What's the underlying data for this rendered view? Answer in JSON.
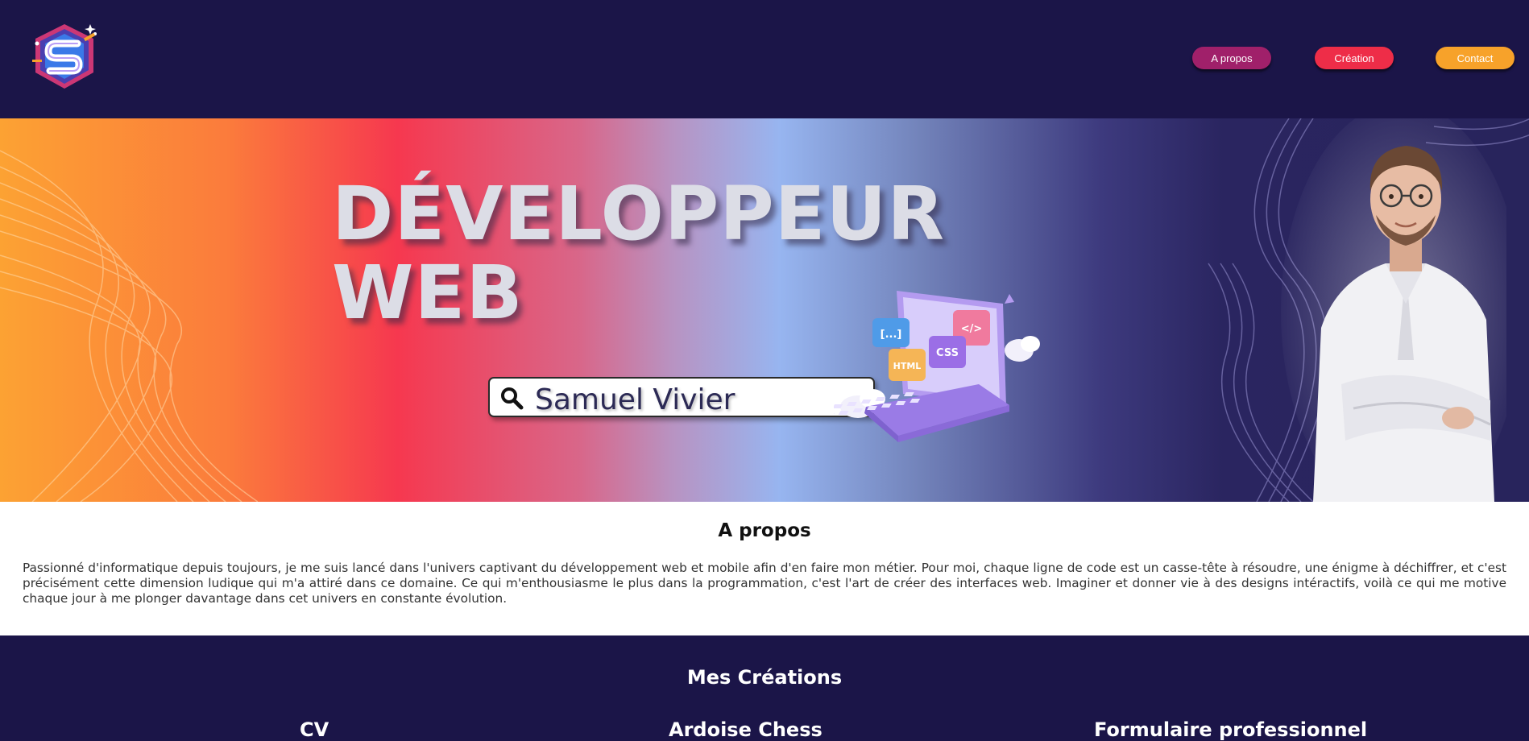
{
  "header": {
    "nav": [
      {
        "label": "A propos",
        "color": "#a0206a"
      },
      {
        "label": "Création",
        "color": "#ee2d48"
      },
      {
        "label": "Contact",
        "color": "#f7a22a"
      }
    ]
  },
  "hero": {
    "title_line1": "DÉVELOPPEUR",
    "title_line2": "WEB",
    "search_value": "Samuel Vivier",
    "laptop_labels": {
      "brackets": "[...]",
      "code": "</>",
      "html": "HTML",
      "css": "CSS"
    }
  },
  "about": {
    "title": "A propos",
    "text": "Passionné d'informatique depuis toujours, je me suis lancé dans l'univers captivant du développement web et mobile afin d'en faire mon métier. Pour moi, chaque ligne de code est un casse-tête à résoudre, une énigme à déchiffrer, et c'est précisément cette dimension ludique qui m'a attiré dans ce domaine. Ce qui m'enthousiasme le plus dans la programmation, c'est l'art de créer des interfaces web. Imaginer et donner vie à des designs intéractifs, voilà ce qui me motive chaque jour à me plonger davantage dans cet univers en constante évolution."
  },
  "creations": {
    "title": "Mes Créations",
    "cards": [
      {
        "title": "CV"
      },
      {
        "title": "Ardoise Chess"
      },
      {
        "title": "Formulaire professionnel"
      }
    ]
  },
  "colors": {
    "background": "#1b1548",
    "about_bg": "#ffffff",
    "hero_orange": "#fca233",
    "hero_red": "#f6384f",
    "hero_blue": "#97b5f0",
    "hero_navy": "#28245c"
  },
  "icons": [
    "logo-s-icon",
    "search-icon",
    "laptop-illustration",
    "portrait-photo"
  ]
}
